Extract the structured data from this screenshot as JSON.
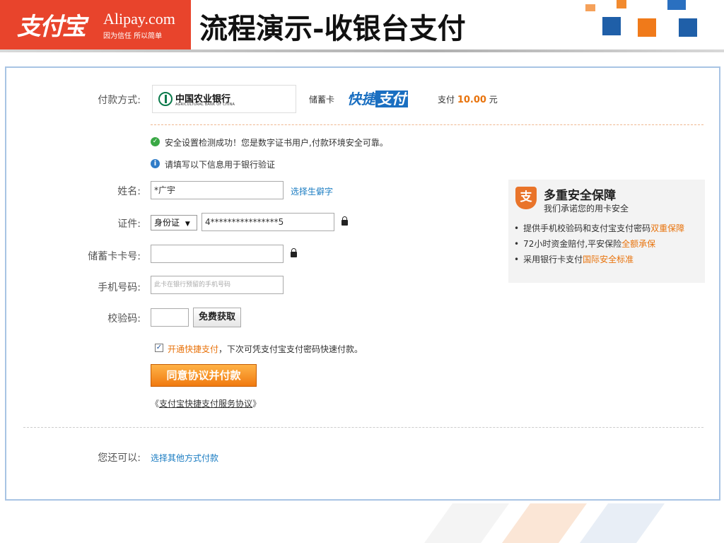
{
  "slide": {
    "logo_zh": "支付宝",
    "logo_en": "Alipay.com",
    "logo_slogan": "因为信任 所以简单",
    "title": "流程演示-收银台支付"
  },
  "payment": {
    "method_label": "付款方式:",
    "bank_name": "中国农业银行",
    "bank_name_en": "AGRICULTURAL BANK OF CHINA",
    "card_type": "储蓄卡",
    "quick_pay_part1": "快捷",
    "quick_pay_part2": "支付",
    "amount_prefix": "支付",
    "amount": "10.00",
    "amount_unit": "元"
  },
  "notices": {
    "success": "安全设置检测成功！您是数字证书用户,付款环境安全可靠。",
    "info": "请填写以下信息用于银行验证"
  },
  "form": {
    "name_label": "姓名:",
    "name_value": "*广宇",
    "name_link": "选择生僻字",
    "id_label": "证件:",
    "id_type": "身份证",
    "id_value": "4****************5",
    "card_label": "储蓄卡卡号:",
    "card_value": "",
    "phone_label": "手机号码:",
    "phone_placeholder": "此卡在银行预留的手机号码",
    "code_label": "校验码:",
    "code_value": "",
    "code_button": "免费获取",
    "quickpay_check_highlight": "开通快捷支付",
    "quickpay_check_rest": "，下次可凭支付宝支付密码快速付款。",
    "submit_button": "同意协议并付款",
    "agreement_open": "《",
    "agreement_link": "支付宝快捷支付服务协议",
    "agreement_close": "》"
  },
  "alternatives": {
    "label": "您还可以:",
    "link": "选择其他方式付款"
  },
  "security_panel": {
    "title": "多重安全保障",
    "subtitle": "我们承诺您的用卡安全",
    "items": [
      {
        "text": "提供手机校验码和支付宝支付密码",
        "highlight": "双重保障"
      },
      {
        "text": "72小时资金赔付,平安保险",
        "highlight": "全额承保"
      },
      {
        "text": "采用银行卡支付",
        "highlight": "国际安全标准"
      }
    ]
  },
  "colors": {
    "brand_red": "#e8442c",
    "accent_orange": "#e8730c",
    "link_blue": "#1a7cc2",
    "frame_border": "#a8c4e4"
  }
}
